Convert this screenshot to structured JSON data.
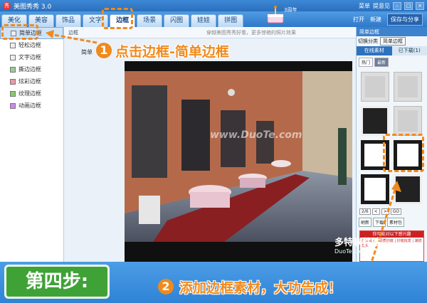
{
  "app": {
    "title": "美图秀秀 3.0",
    "logo": "秀"
  },
  "window": {
    "menu": "菜单",
    "feedback": "提意见"
  },
  "tabs": [
    "美化",
    "美容",
    "饰品",
    "文字",
    "边框",
    "场景",
    "闪图",
    "娃娃",
    "拼图"
  ],
  "active_tab": "边框",
  "toolbar": {
    "open": "打开",
    "new": "新建",
    "save": "保存与分享"
  },
  "anniversary": "3周年",
  "left_panel": {
    "items": [
      {
        "label": "简单边框",
        "selected": true
      },
      {
        "label": "轻松边框",
        "selected": false
      },
      {
        "label": "文字边框",
        "selected": false
      },
      {
        "label": "撕边边框",
        "selected": false
      },
      {
        "label": "炫彩边框",
        "selected": false
      },
      {
        "label": "纹理边框",
        "selected": false
      },
      {
        "label": "动画边框",
        "selected": false
      }
    ]
  },
  "center": {
    "header": "边框",
    "hint": "穿越美图秀秀好看，更多惊艳的照片效果",
    "canvas_label": "简单",
    "watermark": "www.DuoTe.com"
  },
  "right_panel": {
    "category_label": "切换分类",
    "category_value": "简单边框",
    "tabs": [
      "在线素材",
      "已下载(1)"
    ],
    "subtabs": [
      "热门",
      "最新"
    ],
    "pager": "2/6",
    "go": "GO",
    "actions": [
      "刷新",
      "下载",
      "素材包"
    ],
    "ad_head": "你可能对以下感兴趣",
    "ad_body": "抄底批发 | 原质抄底 | 抄底批发 | 潮流龙头"
  },
  "overlays": {
    "step1_num": "1",
    "step1_text": "点击边框-简单边框",
    "step2_num": "2",
    "step2_text": "添加边框素材，大功告成！",
    "step_label": "第四步:",
    "site_logo": "多特软件站",
    "site_url": "DuoTe.com"
  },
  "colors": {
    "accent": "#f08a1c",
    "brand_blue": "#2f79c9",
    "step_green": "#3fa237"
  }
}
